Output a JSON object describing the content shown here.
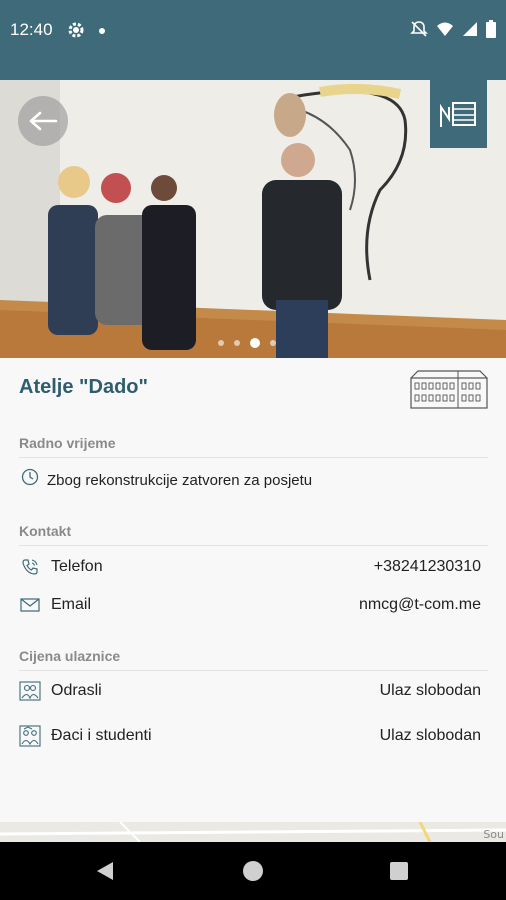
{
  "status_bar": {
    "time": "12:40"
  },
  "place": {
    "title": "Atelje \"Dado\""
  },
  "sections": {
    "hours_label": "Radno vrijeme",
    "hours_text": "Zbog rekonstrukcije zatvoren za posjetu",
    "contact_label": "Kontakt",
    "phone_label": "Telefon",
    "phone_value": "+38241230310",
    "email_label": "Email",
    "email_value": "nmcg@t-com.me",
    "price_label": "Cijena ulaznice",
    "adults_label": "Odrasli",
    "adults_value": "Ulaz slobodan",
    "students_label": "Đaci i studenti",
    "students_value": "Ulaz slobodan"
  },
  "gallery": {
    "page_count": 4,
    "active_index": 2
  },
  "map": {
    "partial_label": "Sou"
  },
  "colors": {
    "primary": "#3e6a79",
    "title": "#2f5d6e"
  },
  "icons": [
    "settings-icon",
    "notification-dot",
    "mute-icon",
    "wifi-icon",
    "signal-icon",
    "battery-icon",
    "back-arrow-icon",
    "museum-logo-icon",
    "building-icon",
    "clock-icon",
    "phone-icon",
    "mail-icon",
    "adults-icon",
    "students-icon"
  ]
}
